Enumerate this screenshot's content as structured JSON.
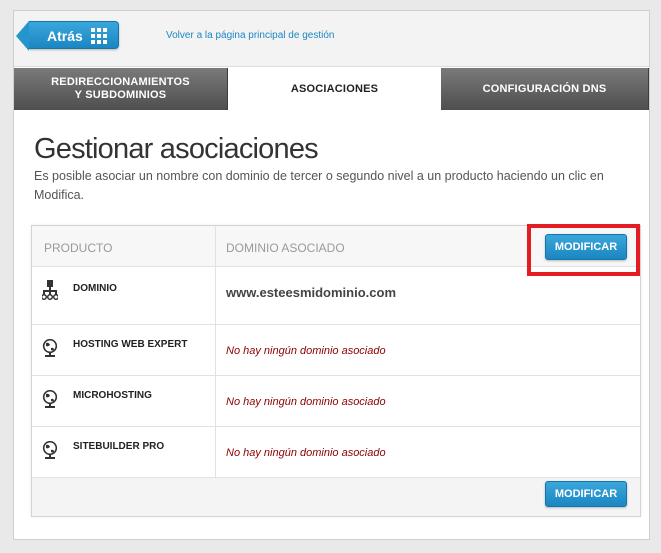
{
  "topbar": {
    "back_label": "Atrás",
    "home_link": "Volver a la página principal de gestión"
  },
  "tabs": [
    {
      "label": "REDIRECCIONAMIENTOS\nY SUBDOMINIOS",
      "active": false
    },
    {
      "label": "ASOCIACIONES",
      "active": true
    },
    {
      "label": "CONFIGURACIÓN DNS",
      "active": false
    }
  ],
  "main": {
    "title": "Gestionar asociaciones",
    "description": "Es posible asociar un nombre con dominio de tercer o segundo nivel a un producto haciendo un clic en Modifica."
  },
  "table": {
    "headers": {
      "product": "PRODUCTO",
      "domain": "DOMINIO ASOCIADO"
    },
    "modify_label": "MODIFICAR",
    "rows": [
      {
        "icon": "network-icon",
        "product": "DOMINIO",
        "domain": "www.esteesmidominio.com"
      },
      {
        "icon": "globe-icon",
        "product": "HOSTING WEB EXPERT",
        "domain": "No hay ningún dominio asociado"
      },
      {
        "icon": "globe-icon",
        "product": "MICROHOSTING",
        "domain": "No hay ningún dominio asociado"
      },
      {
        "icon": "globe-icon",
        "product": "SITEBUILDER PRO",
        "domain": "No hay ningún dominio asociado"
      }
    ]
  },
  "colors": {
    "accent": "#1b86c1",
    "highlight": "#e31b23",
    "empty_domain": "#8b0000"
  }
}
